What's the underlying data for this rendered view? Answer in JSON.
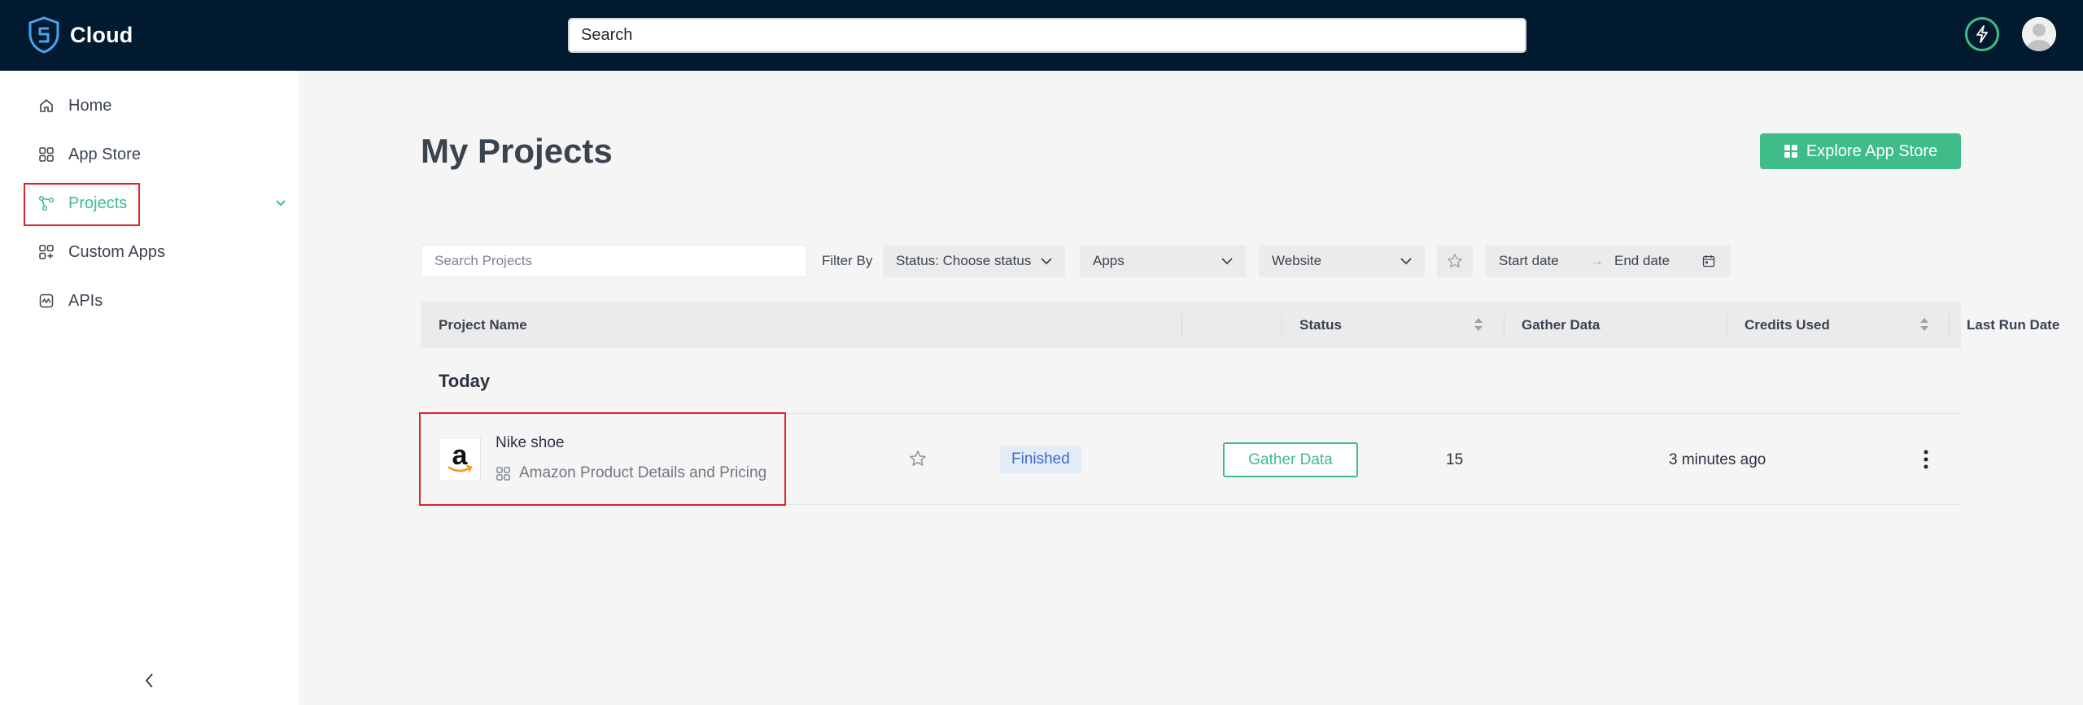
{
  "header": {
    "app_name": "Cloud",
    "search_placeholder": "Search"
  },
  "sidebar": {
    "items": [
      {
        "label": "Home",
        "icon": "home-icon"
      },
      {
        "label": "App Store",
        "icon": "grid-icon"
      },
      {
        "label": "Projects",
        "icon": "nodes-icon",
        "active": true
      },
      {
        "label": "Custom Apps",
        "icon": "grid-plus-icon"
      },
      {
        "label": "APIs",
        "icon": "api-icon"
      }
    ]
  },
  "main": {
    "title": "My Projects",
    "explore_button": "Explore App Store",
    "filters": {
      "search_placeholder": "Search Projects",
      "filter_by_label": "Filter By",
      "status": "Status: Choose status",
      "apps": "Apps",
      "website": "Website",
      "start_date": "Start date",
      "end_date": "End date"
    },
    "table": {
      "columns": [
        "Project Name",
        "Status",
        "Gather Data",
        "Credits Used",
        "Last Run Date"
      ],
      "groups": [
        {
          "label": "Today",
          "rows": [
            {
              "name": "Nike shoe",
              "app": "Amazon Product Details and Pricing",
              "status": "Finished",
              "gather_label": "Gather Data",
              "credits": "15",
              "last_run": "3 minutes ago"
            }
          ]
        }
      ]
    }
  },
  "colors": {
    "header_bg": "#021a30",
    "accent": "#3ebd8a",
    "status_bg": "#e3ebf6",
    "status_text": "#3c6cc6",
    "highlight": "#e0262b"
  }
}
